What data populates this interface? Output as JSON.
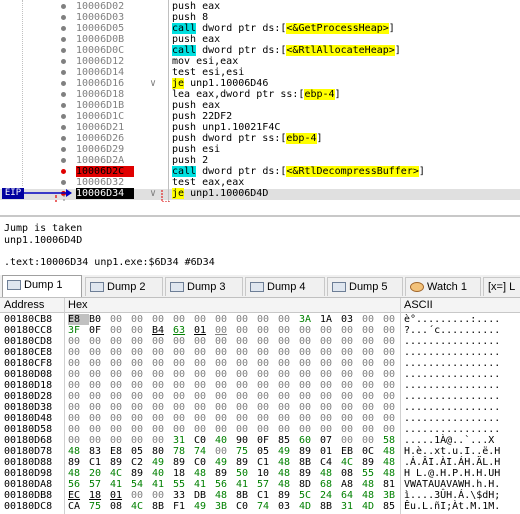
{
  "disasm": {
    "eip_label": "EIP",
    "rows": [
      {
        "addr": "10006D02",
        "arrow": "",
        "parts": [
          [
            "push eax",
            ""
          ]
        ],
        "bp": false,
        "eip": false
      },
      {
        "addr": "10006D03",
        "arrow": "",
        "parts": [
          [
            "push 8",
            ""
          ]
        ],
        "bp": false,
        "eip": false
      },
      {
        "addr": "10006D05",
        "arrow": "",
        "parts": [
          [
            "call",
            "call"
          ],
          [
            " dword ptr ds:[",
            ""
          ],
          [
            "<&GetProcessHeap>",
            "api"
          ],
          [
            "]",
            ""
          ]
        ],
        "bp": false,
        "eip": false
      },
      {
        "addr": "10006D0B",
        "arrow": "",
        "parts": [
          [
            "push eax",
            ""
          ]
        ],
        "bp": false,
        "eip": false
      },
      {
        "addr": "10006D0C",
        "arrow": "",
        "parts": [
          [
            "call",
            "call"
          ],
          [
            " dword ptr ds:[",
            ""
          ],
          [
            "<&RtlAllocateHeap>",
            "api"
          ],
          [
            "]",
            ""
          ]
        ],
        "bp": false,
        "eip": false
      },
      {
        "addr": "10006D12",
        "arrow": "",
        "parts": [
          [
            "mov esi,eax",
            ""
          ]
        ],
        "bp": false,
        "eip": false
      },
      {
        "addr": "10006D14",
        "arrow": "",
        "parts": [
          [
            "test esi,esi",
            ""
          ]
        ],
        "bp": false,
        "eip": false
      },
      {
        "addr": "10006D16",
        "arrow": "∨",
        "parts": [
          [
            "je",
            "jmp"
          ],
          [
            " unp1.10006D46",
            ""
          ]
        ],
        "bp": false,
        "eip": false
      },
      {
        "addr": "10006D18",
        "arrow": "",
        "parts": [
          [
            "lea eax,dword ptr ss:[",
            ""
          ],
          [
            "ebp-4",
            "api"
          ],
          [
            "]",
            ""
          ]
        ],
        "bp": false,
        "eip": false
      },
      {
        "addr": "10006D1B",
        "arrow": "",
        "parts": [
          [
            "push eax",
            ""
          ]
        ],
        "bp": false,
        "eip": false
      },
      {
        "addr": "10006D1C",
        "arrow": "",
        "parts": [
          [
            "push 22DF2",
            ""
          ]
        ],
        "bp": false,
        "eip": false
      },
      {
        "addr": "10006D21",
        "arrow": "",
        "parts": [
          [
            "push unp1.10021F4C",
            ""
          ]
        ],
        "bp": false,
        "eip": false
      },
      {
        "addr": "10006D26",
        "arrow": "",
        "parts": [
          [
            "push dword ptr ss:[",
            ""
          ],
          [
            "ebp-4",
            "api"
          ],
          [
            "]",
            ""
          ]
        ],
        "bp": false,
        "eip": false
      },
      {
        "addr": "10006D29",
        "arrow": "",
        "parts": [
          [
            "push esi",
            ""
          ]
        ],
        "bp": false,
        "eip": false
      },
      {
        "addr": "10006D2A",
        "arrow": "",
        "parts": [
          [
            "push 2",
            ""
          ]
        ],
        "bp": false,
        "eip": false
      },
      {
        "addr": "10006D2C",
        "arrow": "",
        "parts": [
          [
            "call",
            "call"
          ],
          [
            " dword ptr ds:[",
            ""
          ],
          [
            "<&RtlDecompressBuffer>",
            "api"
          ],
          [
            "]",
            ""
          ]
        ],
        "bp": true,
        "eip": false
      },
      {
        "addr": "10006D32",
        "arrow": "",
        "parts": [
          [
            "test eax,eax",
            ""
          ]
        ],
        "bp": false,
        "eip": false
      },
      {
        "addr": "10006D34",
        "arrow": "∨",
        "parts": [
          [
            "je",
            "jmp"
          ],
          [
            " unp1.10006D4D",
            ""
          ]
        ],
        "bp": true,
        "eip": true
      }
    ]
  },
  "info": {
    "line1": "Jump is taken",
    "line2": "unp1.10006D4D",
    "line3": ".text:10006D34 unp1.exe:$6D34 #6D34"
  },
  "tabs": [
    {
      "label": "Dump 1",
      "active": true
    },
    {
      "label": "Dump 2",
      "active": false
    },
    {
      "label": "Dump 3",
      "active": false
    },
    {
      "label": "Dump 4",
      "active": false
    },
    {
      "label": "Dump 5",
      "active": false
    },
    {
      "label": "Watch 1",
      "active": false
    },
    {
      "label": "[x=] L",
      "active": false
    }
  ],
  "dump": {
    "col_address": "Address",
    "col_hex": "Hex",
    "col_ascii": "ASCII",
    "rows": [
      {
        "addr": "00180CB8",
        "hex": [
          "E8",
          "B0",
          "00",
          "00",
          "00",
          "00",
          "00",
          "00",
          "00",
          "00",
          "00",
          "3A",
          "1A",
          "03",
          "00",
          "00"
        ],
        "ascii": "è°.........:...."
      },
      {
        "addr": "00180CC8",
        "hex": [
          "3F",
          "0F",
          "00",
          "00",
          "B4",
          "63",
          "01",
          "00",
          "00",
          "00",
          "00",
          "00",
          "00",
          "00",
          "00",
          "00"
        ],
        "ascii": "?...´c.........."
      },
      {
        "addr": "00180CD8",
        "hex": [
          "00",
          "00",
          "00",
          "00",
          "00",
          "00",
          "00",
          "00",
          "00",
          "00",
          "00",
          "00",
          "00",
          "00",
          "00",
          "00"
        ],
        "ascii": "................"
      },
      {
        "addr": "00180CE8",
        "hex": [
          "00",
          "00",
          "00",
          "00",
          "00",
          "00",
          "00",
          "00",
          "00",
          "00",
          "00",
          "00",
          "00",
          "00",
          "00",
          "00"
        ],
        "ascii": "................"
      },
      {
        "addr": "00180CF8",
        "hex": [
          "00",
          "00",
          "00",
          "00",
          "00",
          "00",
          "00",
          "00",
          "00",
          "00",
          "00",
          "00",
          "00",
          "00",
          "00",
          "00"
        ],
        "ascii": "................"
      },
      {
        "addr": "00180D08",
        "hex": [
          "00",
          "00",
          "00",
          "00",
          "00",
          "00",
          "00",
          "00",
          "00",
          "00",
          "00",
          "00",
          "00",
          "00",
          "00",
          "00"
        ],
        "ascii": "................"
      },
      {
        "addr": "00180D18",
        "hex": [
          "00",
          "00",
          "00",
          "00",
          "00",
          "00",
          "00",
          "00",
          "00",
          "00",
          "00",
          "00",
          "00",
          "00",
          "00",
          "00"
        ],
        "ascii": "................"
      },
      {
        "addr": "00180D28",
        "hex": [
          "00",
          "00",
          "00",
          "00",
          "00",
          "00",
          "00",
          "00",
          "00",
          "00",
          "00",
          "00",
          "00",
          "00",
          "00",
          "00"
        ],
        "ascii": "................"
      },
      {
        "addr": "00180D38",
        "hex": [
          "00",
          "00",
          "00",
          "00",
          "00",
          "00",
          "00",
          "00",
          "00",
          "00",
          "00",
          "00",
          "00",
          "00",
          "00",
          "00"
        ],
        "ascii": "................"
      },
      {
        "addr": "00180D48",
        "hex": [
          "00",
          "00",
          "00",
          "00",
          "00",
          "00",
          "00",
          "00",
          "00",
          "00",
          "00",
          "00",
          "00",
          "00",
          "00",
          "00"
        ],
        "ascii": "................"
      },
      {
        "addr": "00180D58",
        "hex": [
          "00",
          "00",
          "00",
          "00",
          "00",
          "00",
          "00",
          "00",
          "00",
          "00",
          "00",
          "00",
          "00",
          "00",
          "00",
          "00"
        ],
        "ascii": "................"
      },
      {
        "addr": "00180D68",
        "hex": [
          "00",
          "00",
          "00",
          "00",
          "00",
          "31",
          "C0",
          "40",
          "90",
          "0F",
          "85",
          "60",
          "07",
          "00",
          "00",
          "58"
        ],
        "ascii": ".....1À@..`...X"
      },
      {
        "addr": "00180D78",
        "hex": [
          "48",
          "83",
          "E8",
          "05",
          "80",
          "78",
          "74",
          "00",
          "75",
          "05",
          "49",
          "89",
          "01",
          "EB",
          "0C",
          "48"
        ],
        "ascii": "H.è..xt.u.I..ë.H"
      },
      {
        "addr": "00180D88",
        "hex": [
          "89",
          "C1",
          "89",
          "C2",
          "49",
          "89",
          "C0",
          "49",
          "89",
          "C1",
          "48",
          "8B",
          "C4",
          "4C",
          "89",
          "48"
        ],
        "ascii": ".Á.ÂI.ÀI.ÁH.ÄL.H"
      },
      {
        "addr": "00180D98",
        "hex": [
          "48",
          "20",
          "4C",
          "89",
          "40",
          "18",
          "48",
          "89",
          "50",
          "10",
          "48",
          "89",
          "48",
          "08",
          "55",
          "48"
        ],
        "ascii": "H L.@.H.P.H.H.UH"
      },
      {
        "addr": "00180DA8",
        "hex": [
          "56",
          "57",
          "41",
          "54",
          "41",
          "55",
          "41",
          "56",
          "41",
          "57",
          "48",
          "8D",
          "68",
          "A8",
          "48",
          "81"
        ],
        "ascii": "VWATAUAVAWH.h.H."
      },
      {
        "addr": "00180DB8",
        "hex": [
          "EC",
          "18",
          "01",
          "00",
          "00",
          "33",
          "DB",
          "48",
          "8B",
          "C1",
          "89",
          "5C",
          "24",
          "64",
          "48",
          "3B"
        ],
        "ascii": "ì....3ÛH.Á.\\$dH;"
      },
      {
        "addr": "00180DC8",
        "hex": [
          "CA",
          "75",
          "08",
          "4C",
          "8B",
          "F1",
          "49",
          "3B",
          "C0",
          "74",
          "03",
          "4D",
          "8B",
          "31",
          "4D",
          "85"
        ],
        "ascii": "Êu.L.ñI;Àt.M.1M."
      }
    ]
  }
}
